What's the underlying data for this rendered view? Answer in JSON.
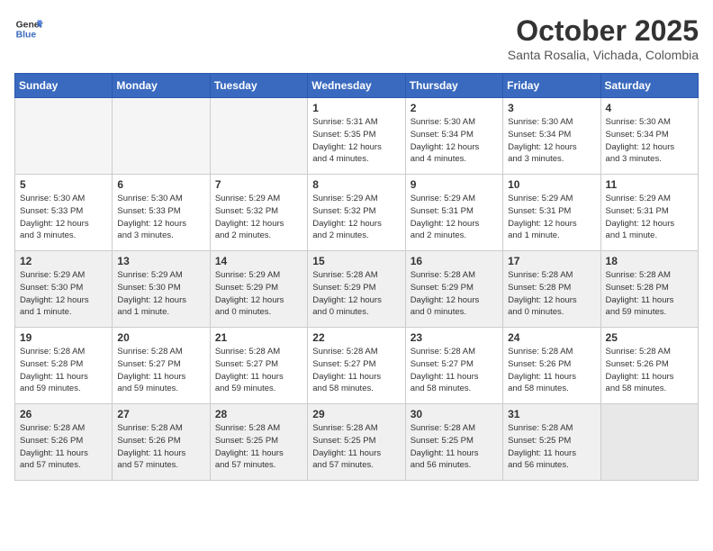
{
  "header": {
    "logo_line1": "General",
    "logo_line2": "Blue",
    "month_title": "October 2025",
    "location": "Santa Rosalia, Vichada, Colombia"
  },
  "weekdays": [
    "Sunday",
    "Monday",
    "Tuesday",
    "Wednesday",
    "Thursday",
    "Friday",
    "Saturday"
  ],
  "weeks": [
    {
      "shaded": false,
      "days": [
        {
          "num": "",
          "info": ""
        },
        {
          "num": "",
          "info": ""
        },
        {
          "num": "",
          "info": ""
        },
        {
          "num": "1",
          "info": "Sunrise: 5:31 AM\nSunset: 5:35 PM\nDaylight: 12 hours\nand 4 minutes."
        },
        {
          "num": "2",
          "info": "Sunrise: 5:30 AM\nSunset: 5:34 PM\nDaylight: 12 hours\nand 4 minutes."
        },
        {
          "num": "3",
          "info": "Sunrise: 5:30 AM\nSunset: 5:34 PM\nDaylight: 12 hours\nand 3 minutes."
        },
        {
          "num": "4",
          "info": "Sunrise: 5:30 AM\nSunset: 5:34 PM\nDaylight: 12 hours\nand 3 minutes."
        }
      ]
    },
    {
      "shaded": false,
      "days": [
        {
          "num": "5",
          "info": "Sunrise: 5:30 AM\nSunset: 5:33 PM\nDaylight: 12 hours\nand 3 minutes."
        },
        {
          "num": "6",
          "info": "Sunrise: 5:30 AM\nSunset: 5:33 PM\nDaylight: 12 hours\nand 3 minutes."
        },
        {
          "num": "7",
          "info": "Sunrise: 5:29 AM\nSunset: 5:32 PM\nDaylight: 12 hours\nand 2 minutes."
        },
        {
          "num": "8",
          "info": "Sunrise: 5:29 AM\nSunset: 5:32 PM\nDaylight: 12 hours\nand 2 minutes."
        },
        {
          "num": "9",
          "info": "Sunrise: 5:29 AM\nSunset: 5:31 PM\nDaylight: 12 hours\nand 2 minutes."
        },
        {
          "num": "10",
          "info": "Sunrise: 5:29 AM\nSunset: 5:31 PM\nDaylight: 12 hours\nand 1 minute."
        },
        {
          "num": "11",
          "info": "Sunrise: 5:29 AM\nSunset: 5:31 PM\nDaylight: 12 hours\nand 1 minute."
        }
      ]
    },
    {
      "shaded": true,
      "days": [
        {
          "num": "12",
          "info": "Sunrise: 5:29 AM\nSunset: 5:30 PM\nDaylight: 12 hours\nand 1 minute."
        },
        {
          "num": "13",
          "info": "Sunrise: 5:29 AM\nSunset: 5:30 PM\nDaylight: 12 hours\nand 1 minute."
        },
        {
          "num": "14",
          "info": "Sunrise: 5:29 AM\nSunset: 5:29 PM\nDaylight: 12 hours\nand 0 minutes."
        },
        {
          "num": "15",
          "info": "Sunrise: 5:28 AM\nSunset: 5:29 PM\nDaylight: 12 hours\nand 0 minutes."
        },
        {
          "num": "16",
          "info": "Sunrise: 5:28 AM\nSunset: 5:29 PM\nDaylight: 12 hours\nand 0 minutes."
        },
        {
          "num": "17",
          "info": "Sunrise: 5:28 AM\nSunset: 5:28 PM\nDaylight: 12 hours\nand 0 minutes."
        },
        {
          "num": "18",
          "info": "Sunrise: 5:28 AM\nSunset: 5:28 PM\nDaylight: 11 hours\nand 59 minutes."
        }
      ]
    },
    {
      "shaded": false,
      "days": [
        {
          "num": "19",
          "info": "Sunrise: 5:28 AM\nSunset: 5:28 PM\nDaylight: 11 hours\nand 59 minutes."
        },
        {
          "num": "20",
          "info": "Sunrise: 5:28 AM\nSunset: 5:27 PM\nDaylight: 11 hours\nand 59 minutes."
        },
        {
          "num": "21",
          "info": "Sunrise: 5:28 AM\nSunset: 5:27 PM\nDaylight: 11 hours\nand 59 minutes."
        },
        {
          "num": "22",
          "info": "Sunrise: 5:28 AM\nSunset: 5:27 PM\nDaylight: 11 hours\nand 58 minutes."
        },
        {
          "num": "23",
          "info": "Sunrise: 5:28 AM\nSunset: 5:27 PM\nDaylight: 11 hours\nand 58 minutes."
        },
        {
          "num": "24",
          "info": "Sunrise: 5:28 AM\nSunset: 5:26 PM\nDaylight: 11 hours\nand 58 minutes."
        },
        {
          "num": "25",
          "info": "Sunrise: 5:28 AM\nSunset: 5:26 PM\nDaylight: 11 hours\nand 58 minutes."
        }
      ]
    },
    {
      "shaded": true,
      "days": [
        {
          "num": "26",
          "info": "Sunrise: 5:28 AM\nSunset: 5:26 PM\nDaylight: 11 hours\nand 57 minutes."
        },
        {
          "num": "27",
          "info": "Sunrise: 5:28 AM\nSunset: 5:26 PM\nDaylight: 11 hours\nand 57 minutes."
        },
        {
          "num": "28",
          "info": "Sunrise: 5:28 AM\nSunset: 5:25 PM\nDaylight: 11 hours\nand 57 minutes."
        },
        {
          "num": "29",
          "info": "Sunrise: 5:28 AM\nSunset: 5:25 PM\nDaylight: 11 hours\nand 57 minutes."
        },
        {
          "num": "30",
          "info": "Sunrise: 5:28 AM\nSunset: 5:25 PM\nDaylight: 11 hours\nand 56 minutes."
        },
        {
          "num": "31",
          "info": "Sunrise: 5:28 AM\nSunset: 5:25 PM\nDaylight: 11 hours\nand 56 minutes."
        },
        {
          "num": "",
          "info": ""
        }
      ]
    }
  ]
}
